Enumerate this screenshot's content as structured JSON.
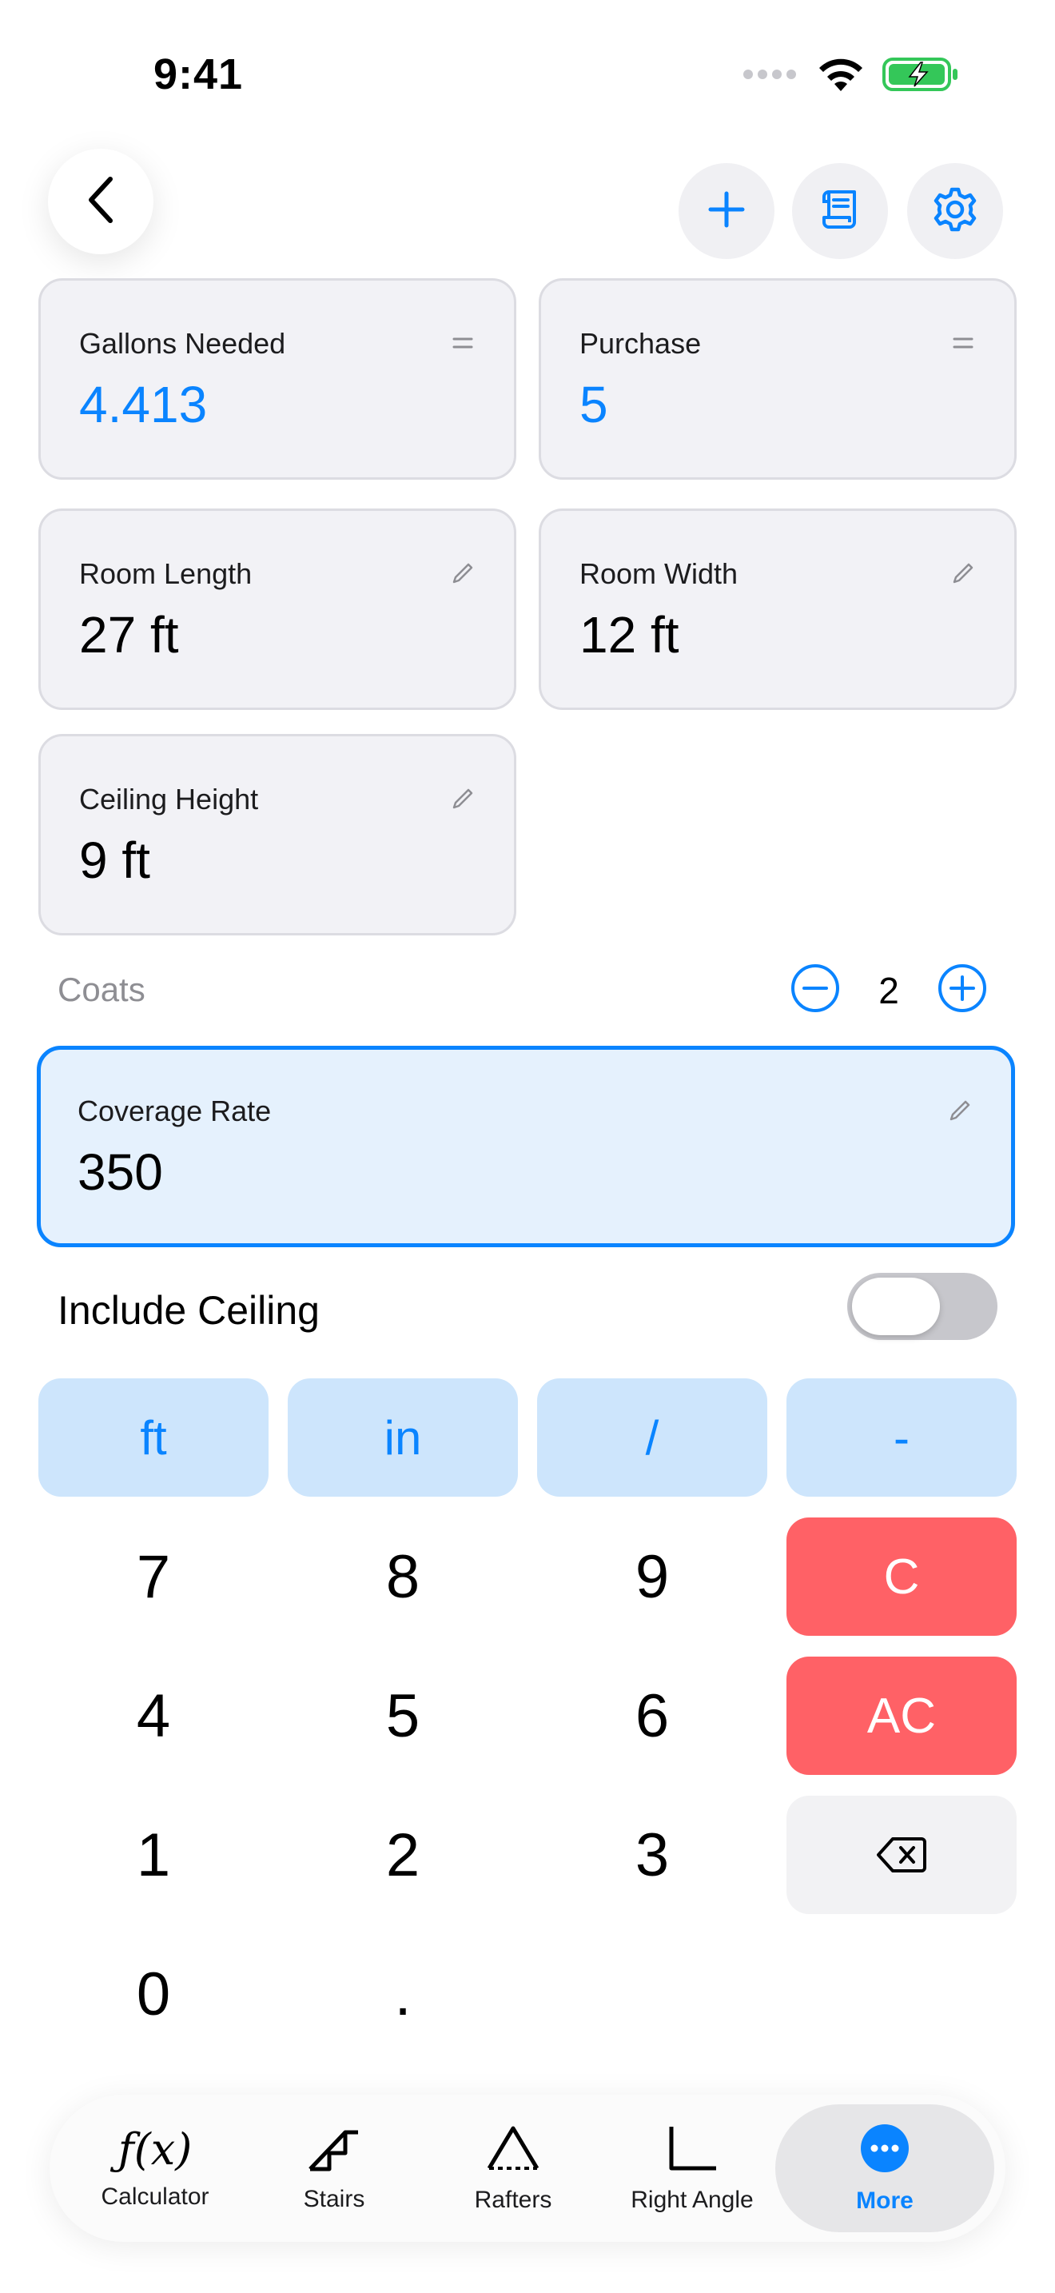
{
  "status_bar": {
    "time": "9:41"
  },
  "cards": {
    "gallons_needed": {
      "label": "Gallons Needed",
      "value": "4.413"
    },
    "purchase": {
      "label": "Purchase",
      "value": "5"
    },
    "room_length": {
      "label": "Room Length",
      "value": "27 ft"
    },
    "room_width": {
      "label": "Room Width",
      "value": "12 ft"
    },
    "ceiling_height": {
      "label": "Ceiling Height",
      "value": "9 ft"
    },
    "coverage_rate": {
      "label": "Coverage Rate",
      "value": "350"
    }
  },
  "coats": {
    "label": "Coats",
    "value": "2"
  },
  "include_ceiling": {
    "label": "Include Ceiling",
    "enabled": false
  },
  "keypad": {
    "units": [
      "ft",
      "in",
      "/",
      "-"
    ],
    "digits": [
      "7",
      "8",
      "9",
      "4",
      "5",
      "6",
      "1",
      "2",
      "3",
      "0",
      "."
    ],
    "clear": "C",
    "all_clear": "AC"
  },
  "tabs": [
    {
      "label": "Calculator",
      "icon": "function-icon"
    },
    {
      "label": "Stairs",
      "icon": "stairs-icon"
    },
    {
      "label": "Rafters",
      "icon": "rafters-icon"
    },
    {
      "label": "Right Angle",
      "icon": "right-angle-icon"
    },
    {
      "label": "More",
      "icon": "more-icon",
      "active": true
    }
  ],
  "colors": {
    "accent": "#0a84ff",
    "clear": "#ff6166",
    "unit_key_bg": "#cde5fc",
    "highlight_card_bg": "#e5f1fd",
    "card_bg": "#f2f2f6"
  }
}
